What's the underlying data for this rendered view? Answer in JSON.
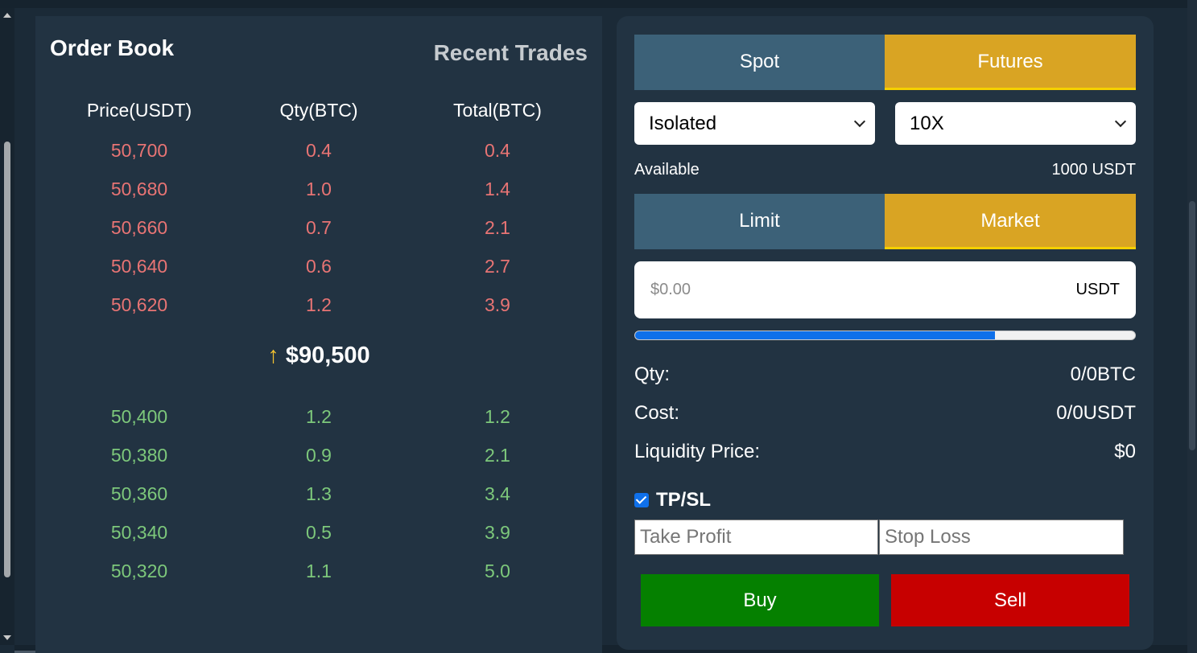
{
  "order_book": {
    "title": "Order Book",
    "recent_trades_tab": "Recent Trades",
    "columns": [
      "Price(USDT)",
      "Qty(BTC)",
      "Total(BTC)"
    ],
    "asks": [
      [
        "50,700",
        "0.4",
        "0.4"
      ],
      [
        "50,680",
        "1.0",
        "1.4"
      ],
      [
        "50,660",
        "0.7",
        "2.1"
      ],
      [
        "50,640",
        "0.6",
        "2.7"
      ],
      [
        "50,620",
        "1.2",
        "3.9"
      ]
    ],
    "mid_price": {
      "arrow": "↑",
      "value": "$90,500"
    },
    "bids": [
      [
        "50,400",
        "1.2",
        "1.2"
      ],
      [
        "50,380",
        "0.9",
        "2.1"
      ],
      [
        "50,360",
        "1.3",
        "3.4"
      ],
      [
        "50,340",
        "0.5",
        "3.9"
      ],
      [
        "50,320",
        "1.1",
        "5.0"
      ]
    ]
  },
  "trade": {
    "market_tabs": [
      {
        "label": "Spot",
        "active": false
      },
      {
        "label": "Futures",
        "active": true
      }
    ],
    "margin_mode": "Isolated",
    "leverage": "10X",
    "available_label": "Available",
    "available_value": "1000 USDT",
    "order_tabs": [
      {
        "label": "Limit",
        "active": false
      },
      {
        "label": "Market",
        "active": true
      }
    ],
    "amount_placeholder": "$0.00",
    "amount_unit": "USDT",
    "slider_percent": 72,
    "qty_label": "Qty:",
    "qty_value": "0/0BTC",
    "cost_label": "Cost:",
    "cost_value": "0/0USDT",
    "liq_label": "Liquidity Price:",
    "liq_value": "$0",
    "tpsl_label": "TP/SL",
    "tpsl_checked": true,
    "take_profit_placeholder": "Take Profit",
    "stop_loss_placeholder": "Stop Loss",
    "buy_label": "Buy",
    "sell_label": "Sell"
  },
  "colors": {
    "ask": "#e87474",
    "bid": "#7dc87b",
    "accent": "#d9a423",
    "buy": "#058000",
    "sell": "#c70000",
    "slider": "#0f70ea"
  }
}
